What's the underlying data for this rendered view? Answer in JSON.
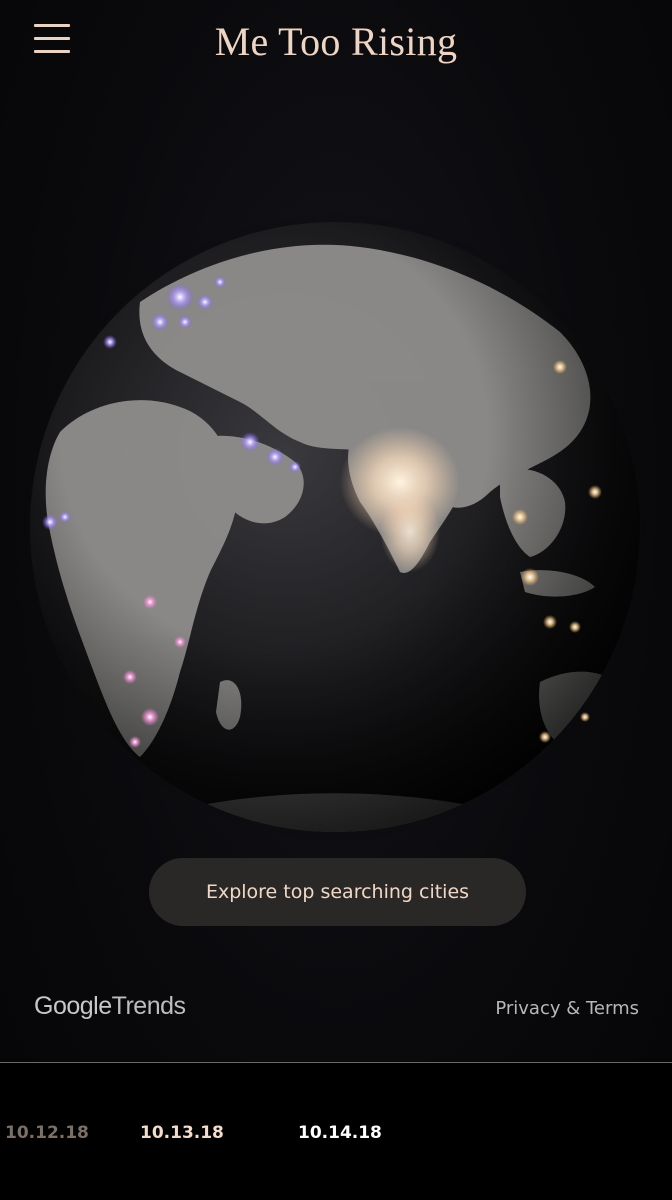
{
  "header": {
    "title": "Me Too Rising",
    "menu_icon": "hamburger-menu-icon"
  },
  "globe": {
    "description_icon": "globe-icon",
    "highlight_colors": {
      "purple": "#b9a2ff",
      "warm": "#ffe9c9",
      "pink": "#ff9ee0"
    }
  },
  "explore_button": {
    "label": "Explore top searching cities"
  },
  "footer": {
    "logo": {
      "google": "Google",
      "trends": "Trends"
    },
    "privacy_label": "Privacy & Terms"
  },
  "timeline": {
    "dates": [
      "10.12.18",
      "10.13.18",
      "10.14.18"
    ]
  }
}
